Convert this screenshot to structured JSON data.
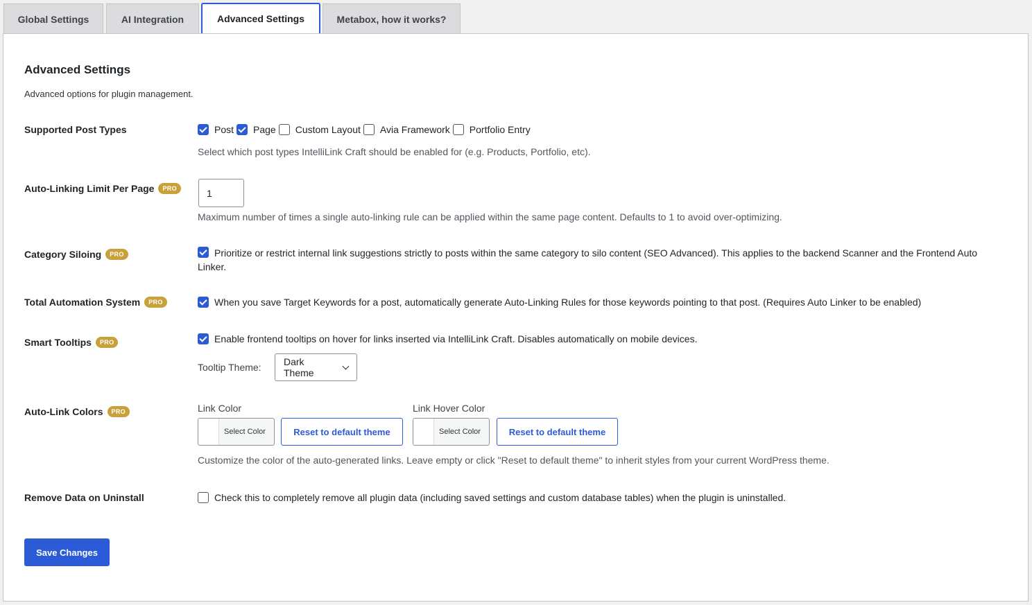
{
  "tabs": [
    {
      "label": "Global Settings",
      "active": false
    },
    {
      "label": "AI Integration",
      "active": false
    },
    {
      "label": "Advanced Settings",
      "active": true
    },
    {
      "label": "Metabox, how it works?",
      "active": false
    }
  ],
  "section": {
    "title": "Advanced Settings",
    "description": "Advanced options for plugin management."
  },
  "pro_badge": "PRO",
  "post_types": {
    "label": "Supported Post Types",
    "options": [
      {
        "label": "Post",
        "checked": true
      },
      {
        "label": "Page",
        "checked": true
      },
      {
        "label": "Custom Layout",
        "checked": false
      },
      {
        "label": "Avia Framework",
        "checked": false
      },
      {
        "label": "Portfolio Entry",
        "checked": false
      }
    ],
    "help": "Select which post types IntelliLink Craft should be enabled for (e.g. Products, Portfolio, etc)."
  },
  "limit": {
    "label": "Auto-Linking Limit Per Page",
    "value": "1",
    "help": "Maximum number of times a single auto-linking rule can be applied within the same page content. Defaults to 1 to avoid over-optimizing."
  },
  "siloing": {
    "label": "Category Siloing",
    "checked": true,
    "text": "Prioritize or restrict internal link suggestions strictly to posts within the same category to silo content (SEO Advanced). This applies to the backend Scanner and the Frontend Auto Linker."
  },
  "automation": {
    "label": "Total Automation System",
    "checked": true,
    "text": "When you save Target Keywords for a post, automatically generate Auto-Linking Rules for those keywords pointing to that post. (Requires Auto Linker to be enabled)"
  },
  "tooltips": {
    "label": "Smart Tooltips",
    "checked": true,
    "text": "Enable frontend tooltips on hover for links inserted via IntelliLink Craft. Disables automatically on mobile devices.",
    "theme_label": "Tooltip Theme:",
    "theme_value": "Dark Theme"
  },
  "colors": {
    "label": "Auto-Link Colors",
    "link_color_label": "Link Color",
    "hover_color_label": "Link Hover Color",
    "select_color": "Select Color",
    "reset_label": "Reset to default theme",
    "help": "Customize the color of the auto-generated links. Leave empty or click \"Reset to default theme\" to inherit styles from your current WordPress theme."
  },
  "uninstall": {
    "label": "Remove Data on Uninstall",
    "checked": false,
    "text": "Check this to completely remove all plugin data (including saved settings and custom database tables) when the plugin is uninstalled."
  },
  "save_label": "Save Changes",
  "accent_color": "#2c5bd8",
  "pro_color": "#c9a13b"
}
